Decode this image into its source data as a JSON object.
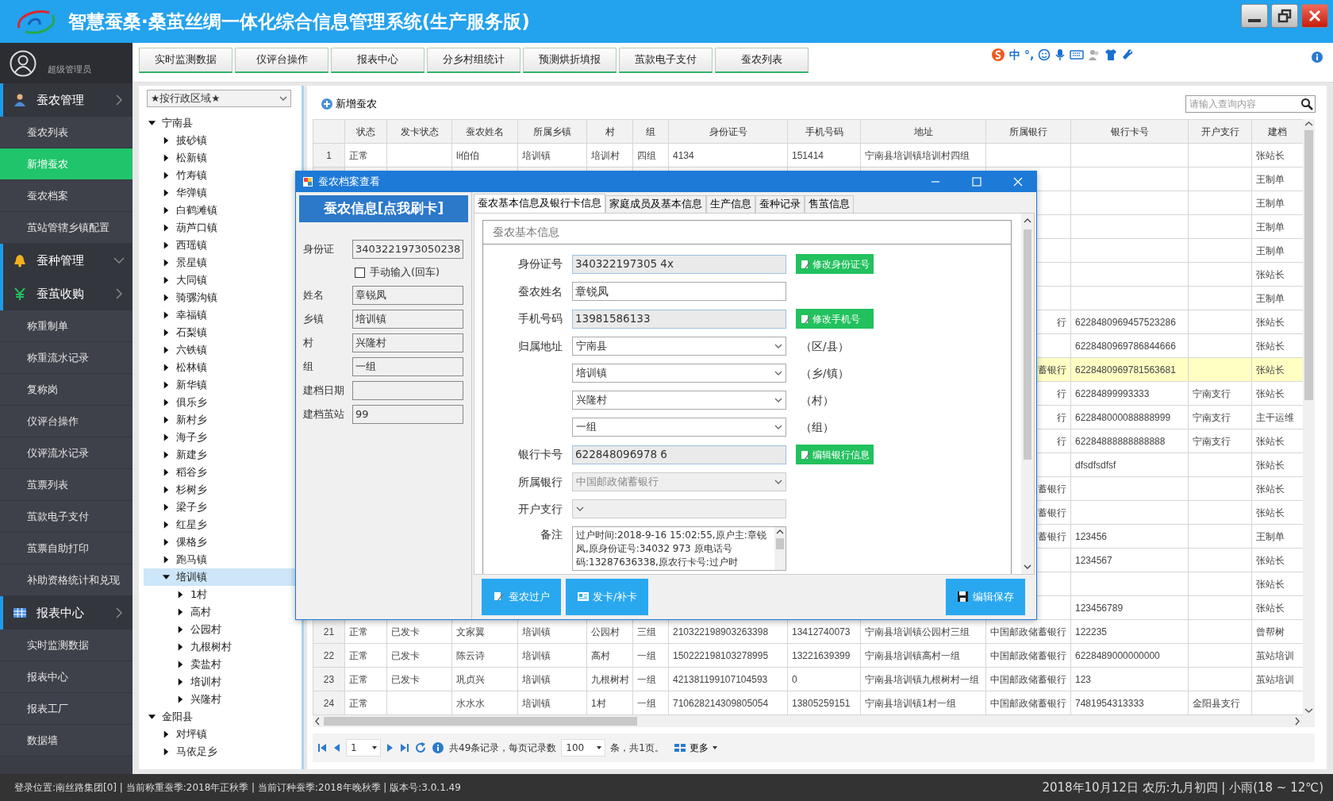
{
  "header": {
    "title": "智慧蚕桑·桑茧丝绸一体化综合信息管理系统(生产服务版)"
  },
  "ime_toolbar": {
    "labels": [
      "中",
      "°,"
    ]
  },
  "user": {
    "role": "超级管理员"
  },
  "top_tabs": [
    {
      "label": "实时监测数据",
      "selected": false
    },
    {
      "label": "仪评台操作",
      "selected": false
    },
    {
      "label": "报表中心",
      "selected": false
    },
    {
      "label": "分乡村组统计",
      "selected": false
    },
    {
      "label": "预测烘折填报",
      "selected": false
    },
    {
      "label": "茧款电子支付",
      "selected": false
    },
    {
      "label": "蚕农列表",
      "selected": false
    }
  ],
  "sidebar": [
    {
      "label": "蚕农管理",
      "expanded": false,
      "items": [
        {
          "label": "蚕农列表",
          "selected": false
        },
        {
          "label": "新增蚕农",
          "selected": true
        },
        {
          "label": "蚕农档案",
          "selected": false
        },
        {
          "label": "茧站管辖乡镇配置",
          "selected": false
        }
      ]
    },
    {
      "label": "蚕种管理",
      "expanded": true
    },
    {
      "label": "蚕茧收购",
      "expanded": false,
      "items": [
        {
          "label": "称重制单",
          "selected": false
        },
        {
          "label": "称重流水记录",
          "selected": false
        },
        {
          "label": "复称岗",
          "selected": false
        },
        {
          "label": "仪评台操作",
          "selected": false
        },
        {
          "label": "仪评流水记录",
          "selected": false
        },
        {
          "label": "茧票列表",
          "selected": false
        },
        {
          "label": "茧款电子支付",
          "selected": false
        },
        {
          "label": "茧票自助打印",
          "selected": false
        },
        {
          "label": "补助资格统计和兑现",
          "selected": false
        }
      ]
    },
    {
      "label": "报表中心",
      "expanded": false,
      "items": [
        {
          "label": "实时监测数据",
          "selected": false
        },
        {
          "label": "报表中心",
          "selected": false
        },
        {
          "label": "报表工厂",
          "selected": false
        },
        {
          "label": "数据墙",
          "selected": false
        }
      ]
    }
  ],
  "region_select": {
    "value": "★按行政区域★"
  },
  "tree": [
    {
      "label": "宁南县",
      "expanded": true,
      "selected": false,
      "children": [
        {
          "label": "披砂镇",
          "expanded": false,
          "selected": false
        },
        {
          "label": "松新镇",
          "expanded": false,
          "selected": false
        },
        {
          "label": "竹寿镇",
          "expanded": false,
          "selected": false
        },
        {
          "label": "华弹镇",
          "expanded": false,
          "selected": false
        },
        {
          "label": "白鹤滩镇",
          "expanded": false,
          "selected": false
        },
        {
          "label": "葫芦口镇",
          "expanded": false,
          "selected": false
        },
        {
          "label": "西瑶镇",
          "expanded": false,
          "selected": false
        },
        {
          "label": "景星镇",
          "expanded": false,
          "selected": false
        },
        {
          "label": "大同镇",
          "expanded": false,
          "selected": false
        },
        {
          "label": "骑骡沟镇",
          "expanded": false,
          "selected": false
        },
        {
          "label": "幸福镇",
          "expanded": false,
          "selected": false
        },
        {
          "label": "石梨镇",
          "expanded": false,
          "selected": false
        },
        {
          "label": "六铁镇",
          "expanded": false,
          "selected": false
        },
        {
          "label": "松林镇",
          "expanded": false,
          "selected": false
        },
        {
          "label": "新华镇",
          "expanded": false,
          "selected": false
        },
        {
          "label": "俱乐乡",
          "expanded": false,
          "selected": false
        },
        {
          "label": "新村乡",
          "expanded": false,
          "selected": false
        },
        {
          "label": "海子乡",
          "expanded": false,
          "selected": false
        },
        {
          "label": "新建乡",
          "expanded": false,
          "selected": false
        },
        {
          "label": "稻谷乡",
          "expanded": false,
          "selected": false
        },
        {
          "label": "杉树乡",
          "expanded": false,
          "selected": false
        },
        {
          "label": "梁子乡",
          "expanded": false,
          "selected": false
        },
        {
          "label": "红星乡",
          "expanded": false,
          "selected": false
        },
        {
          "label": "倮格乡",
          "expanded": false,
          "selected": false
        },
        {
          "label": "跑马镇",
          "expanded": false,
          "selected": false
        },
        {
          "label": "培训镇",
          "expanded": true,
          "selected": true,
          "children": [
            {
              "label": "1村",
              "expanded": false,
              "selected": false
            },
            {
              "label": "高村",
              "expanded": false,
              "selected": false
            },
            {
              "label": "公园村",
              "expanded": false,
              "selected": false
            },
            {
              "label": "九根树村",
              "expanded": false,
              "selected": false
            },
            {
              "label": "卖盐村",
              "expanded": false,
              "selected": false
            },
            {
              "label": "培训村",
              "expanded": false,
              "selected": false
            },
            {
              "label": "兴隆村",
              "expanded": false,
              "selected": false
            }
          ]
        }
      ]
    },
    {
      "label": "金阳县",
      "expanded": true,
      "selected": false,
      "children": [
        {
          "label": "对坪镇",
          "expanded": false,
          "selected": false
        },
        {
          "label": "马依足乡",
          "expanded": false,
          "selected": false
        }
      ]
    }
  ],
  "toolbar": {
    "add_button": "新增蚕农",
    "search": {
      "placeholder": "请输入查询内容"
    }
  },
  "table": {
    "columns": [
      null,
      "状态",
      "发卡状态",
      "蚕农姓名",
      "所属乡镇",
      "村",
      "组",
      "身份证号",
      "手机号码",
      "地址",
      "所属银行",
      "银行卡号",
      "开户支行",
      "建档"
    ],
    "rows": [
      {
        "selected": false,
        "cells": [
          "1",
          "正常",
          null,
          "li伯伯",
          "培训镇",
          "培训村",
          "四组",
          "4134",
          "151414",
          "宁南县培训镇培训村四组",
          null,
          null,
          null,
          "张站长"
        ]
      },
      {
        "selected": false,
        "cells": [
          null,
          null,
          null,
          null,
          null,
          null,
          null,
          null,
          null,
          null,
          null,
          null,
          null,
          "王制单"
        ]
      },
      {
        "selected": false,
        "cells": [
          null,
          null,
          null,
          null,
          null,
          null,
          null,
          null,
          null,
          null,
          null,
          null,
          null,
          "王制单"
        ]
      },
      {
        "selected": false,
        "cells": [
          null,
          null,
          null,
          null,
          null,
          null,
          null,
          null,
          null,
          null,
          null,
          null,
          null,
          "王制单"
        ]
      },
      {
        "selected": false,
        "cells": [
          null,
          null,
          null,
          null,
          null,
          null,
          null,
          null,
          null,
          null,
          null,
          null,
          null,
          "王制单"
        ]
      },
      {
        "selected": false,
        "cells": [
          null,
          null,
          null,
          null,
          null,
          null,
          null,
          null,
          null,
          null,
          null,
          null,
          null,
          "张站长"
        ]
      },
      {
        "selected": false,
        "cells": [
          null,
          null,
          null,
          null,
          null,
          null,
          null,
          null,
          null,
          null,
          null,
          null,
          null,
          "王制单"
        ]
      },
      {
        "selected": false,
        "cells": [
          null,
          null,
          null,
          null,
          null,
          null,
          null,
          null,
          null,
          null,
          "行",
          "6228480969457523286",
          null,
          "张站长"
        ]
      },
      {
        "selected": false,
        "cells": [
          null,
          null,
          null,
          null,
          null,
          null,
          null,
          null,
          null,
          null,
          null,
          "6228480969786844666",
          null,
          "张站长"
        ]
      },
      {
        "selected": true,
        "cells": [
          null,
          null,
          null,
          null,
          null,
          null,
          null,
          null,
          null,
          null,
          "蓄银行",
          "6228480969781563681",
          null,
          "张站长"
        ]
      },
      {
        "selected": false,
        "cells": [
          null,
          null,
          null,
          null,
          null,
          null,
          null,
          null,
          null,
          null,
          "行",
          "62284899993333",
          "宁南支行",
          "张站长"
        ]
      },
      {
        "selected": false,
        "cells": [
          null,
          null,
          null,
          null,
          null,
          null,
          null,
          null,
          null,
          null,
          "行",
          "622848000088888999",
          "宁南支行",
          "主干运维"
        ]
      },
      {
        "selected": false,
        "cells": [
          null,
          null,
          null,
          null,
          null,
          null,
          null,
          null,
          null,
          null,
          "行",
          "62284888888888888",
          "宁南支行",
          "张站长"
        ]
      },
      {
        "selected": false,
        "cells": [
          null,
          null,
          null,
          null,
          null,
          null,
          null,
          null,
          null,
          null,
          null,
          "dfsdfsdfsf",
          null,
          "张站长"
        ]
      },
      {
        "selected": false,
        "cells": [
          null,
          null,
          null,
          null,
          null,
          null,
          null,
          null,
          null,
          null,
          "蓄银行",
          null,
          null,
          "张站长"
        ]
      },
      {
        "selected": false,
        "cells": [
          null,
          null,
          null,
          null,
          null,
          null,
          null,
          null,
          null,
          null,
          "蓄银行",
          null,
          null,
          "张站长"
        ]
      },
      {
        "selected": false,
        "cells": [
          null,
          null,
          null,
          null,
          null,
          null,
          null,
          null,
          null,
          null,
          "蓄银行",
          "123456",
          null,
          "王制单"
        ]
      },
      {
        "selected": false,
        "cells": [
          null,
          null,
          null,
          null,
          null,
          null,
          null,
          null,
          null,
          null,
          null,
          "1234567",
          null,
          "张站长"
        ]
      },
      {
        "selected": false,
        "cells": [
          null,
          null,
          null,
          null,
          null,
          null,
          null,
          null,
          null,
          null,
          null,
          null,
          null,
          "张站长"
        ]
      },
      {
        "selected": false,
        "cells": [
          null,
          null,
          null,
          null,
          null,
          null,
          null,
          null,
          null,
          null,
          null,
          "123456789",
          null,
          "张站长"
        ]
      },
      {
        "selected": false,
        "cells": [
          "21",
          "正常",
          "已发卡",
          "文家翼",
          "培训镇",
          "公园村",
          "三组",
          "210322198903263398",
          "13412740073",
          "宁南县培训镇公园村三组",
          "中国邮政储蓄银行",
          "122235",
          null,
          "曾帮树"
        ]
      },
      {
        "selected": false,
        "cells": [
          "22",
          "正常",
          "已发卡",
          "陈云诗",
          "培训镇",
          "高村",
          "一组",
          "150222198103278995",
          "13221639399",
          "宁南县培训镇高村一组",
          "中国邮政储蓄银行",
          "6228489000000000",
          null,
          "茧站培训"
        ]
      },
      {
        "selected": false,
        "cells": [
          "23",
          "正常",
          "已发卡",
          "巩贞兴",
          "培训镇",
          "九根树村",
          "一组",
          "421381199107104593",
          "0",
          "宁南县培训镇九根树村一组",
          "中国邮政储蓄银行",
          "123",
          null,
          "茧站培训"
        ]
      },
      {
        "selected": false,
        "cells": [
          "24",
          "正常",
          null,
          "水水水",
          "培训镇",
          "1村",
          "一组",
          "710628214309805054",
          "13805259151",
          "宁南县培训镇1村一组",
          "中国邮政储蓄银行",
          "7481954313333",
          "金阳县支行",
          null
        ]
      }
    ]
  },
  "pager": {
    "page": "1",
    "summary": "共49条记录，每页记录数",
    "page_size": "100",
    "pages_text": "条，共1页。",
    "more": "更多"
  },
  "dialog": {
    "title": "蚕农档案查看",
    "card_panel": {
      "header": "蚕农信息[点我刷卡]",
      "fields": [
        {
          "kind": "field",
          "label": "身份证",
          "value": "3403221973050238"
        },
        {
          "kind": "checkbox",
          "label": "手动输入(回车)",
          "checked": false
        },
        {
          "kind": "field",
          "label": "姓名",
          "value": "章锐凤"
        },
        {
          "kind": "field",
          "label": "乡镇",
          "value": "培训镇"
        },
        {
          "kind": "field",
          "label": "村",
          "value": "兴隆村"
        },
        {
          "kind": "field",
          "label": "组",
          "value": "一组"
        },
        {
          "kind": "field",
          "label": "建档日期"
        },
        {
          "kind": "field",
          "label": "建档茧站",
          "value": "99"
        }
      ]
    },
    "tabs": [
      {
        "label": "蚕农基本信息及银行卡信息",
        "selected": true
      },
      {
        "label": "家庭成员及基本信息",
        "selected": false
      },
      {
        "label": "生产信息",
        "selected": false
      },
      {
        "label": "蚕种记录",
        "selected": false
      },
      {
        "label": "售茧信息",
        "selected": false
      }
    ],
    "group_title": "蚕农基本信息",
    "form": [
      {
        "kind": "text",
        "label": "身份证号",
        "value": "340322197305 4x",
        "readonly": true,
        "button": "修改身份证号"
      },
      {
        "kind": "text",
        "label": "蚕农姓名",
        "value": "章锐凤",
        "readonly": false
      },
      {
        "kind": "text",
        "label": "手机号码",
        "value": "13981586133",
        "readonly": true,
        "button": "修改手机号"
      },
      {
        "kind": "select",
        "label": "归属地址",
        "value": "宁南县",
        "unit": "（区/县）",
        "disabled": false
      },
      {
        "kind": "select",
        "value": "培训镇",
        "unit": "（乡/镇）",
        "disabled": false
      },
      {
        "kind": "select",
        "value": "兴隆村",
        "unit": "（村）",
        "disabled": false
      },
      {
        "kind": "select",
        "value": "一组",
        "unit": "（组）",
        "disabled": false
      },
      {
        "kind": "text",
        "label": "银行卡号",
        "value": "622848096978 6",
        "readonly": true,
        "button": "编辑银行信息"
      },
      {
        "kind": "select",
        "label": "所属银行",
        "value": "中国邮政储蓄银行",
        "disabled": true
      },
      {
        "kind": "select",
        "label": "开户支行",
        "disabled": true
      },
      {
        "kind": "textarea",
        "label": "备注",
        "value": "过户时间:2018-9-16 15:02:55,原户主:章锐凤,原身份证号:34032 973   原电话号码:13287636338,原农行卡号:过户时"
      }
    ],
    "left_actions": [
      "蚕农过户",
      "发卡/补卡"
    ],
    "right_actions": [
      "编辑保存"
    ]
  },
  "status_bar": {
    "left": "登录位置:南丝路集团[0] | 当前称重蚕季:2018年正秋季 | 当前订种蚕季:2018年晚秋季 | 版本号:3.0.1.49",
    "right": "2018年10月12日 农历:九月初四 | 小雨(18 ~ 12℃)"
  }
}
